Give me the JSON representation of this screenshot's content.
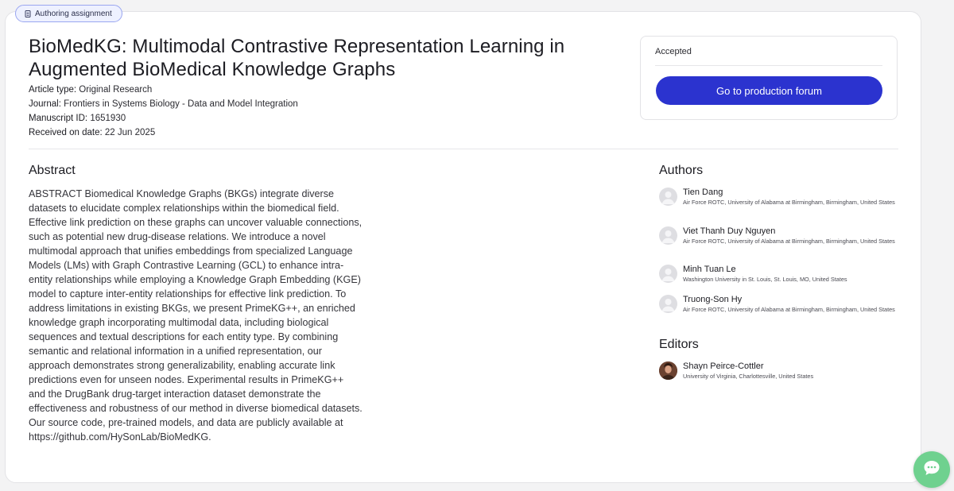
{
  "chip": {
    "label": "Authoring assignment",
    "icon": "document-icon"
  },
  "article": {
    "title": "BioMedKG: Multimodal Contrastive Representation Learning in Augmented BioMedical Knowledge Graphs",
    "meta": [
      {
        "label": "Article type:",
        "value": "Original Research"
      },
      {
        "label": "Journal:",
        "value": "Frontiers in Systems Biology - Data and Model Integration"
      },
      {
        "label": "Manuscript ID:",
        "value": "1651930"
      },
      {
        "label": "Received on date:",
        "value": "22 Jun 2025"
      }
    ]
  },
  "status": {
    "label": "Accepted",
    "button_label": "Go to production forum",
    "button_color": "#2b33cf"
  },
  "abstract": {
    "heading": "Abstract",
    "text": "ABSTRACT Biomedical Knowledge Graphs (BKGs) integrate diverse datasets to elucidate complex relationships within the biomedical field. Effective link prediction on these graphs can uncover valuable connections, such as potential new drug-disease relations. We introduce a novel multimodal approach that unifies embeddings from specialized Language Models (LMs) with Graph Contrastive Learning (GCL) to enhance intra-entity relationships while employing a Knowledge Graph Embedding (KGE) model to capture inter-entity relationships for effective link prediction. To address limitations in existing BKGs, we present PrimeKG++, an enriched knowledge graph incorporating multimodal data, including biological sequences and textual descriptions for each entity type. By combining semantic and relational information in a unified representation, our approach demonstrates strong generalizability, enabling accurate link predictions even for unseen nodes. Experimental results in PrimeKG++ and the DrugBank drug-target interaction dataset demonstrate the effectiveness and robustness of our method in diverse biomedical datasets. Our source code, pre-trained models, and data are publicly available at https://github.com/HySonLab/BioMedKG."
  },
  "authors": {
    "heading": "Authors",
    "items": [
      {
        "name": "Tien Dang",
        "affiliation": "Air Force ROTC, University of Alabama at Birmingham, Birmingham, United States"
      },
      {
        "name": "Viet Thanh Duy Nguyen",
        "affiliation": "Air Force ROTC, University of Alabama at Birmingham, Birmingham, United States"
      },
      {
        "name": "Minh Tuan Le",
        "affiliation": "Washington University in St. Louis, St. Louis, MO, United States"
      },
      {
        "name": "Truong-Son Hy",
        "affiliation": "Air Force ROTC, University of Alabama at Birmingham, Birmingham, United States"
      }
    ]
  },
  "editors": {
    "heading": "Editors",
    "items": [
      {
        "name": "Shayn Peirce-Cottler",
        "affiliation": "University of Virginia, Charlottesville, United States"
      }
    ]
  },
  "chat": {
    "icon": "chat-bubble-icon",
    "color": "#6fd18f"
  }
}
